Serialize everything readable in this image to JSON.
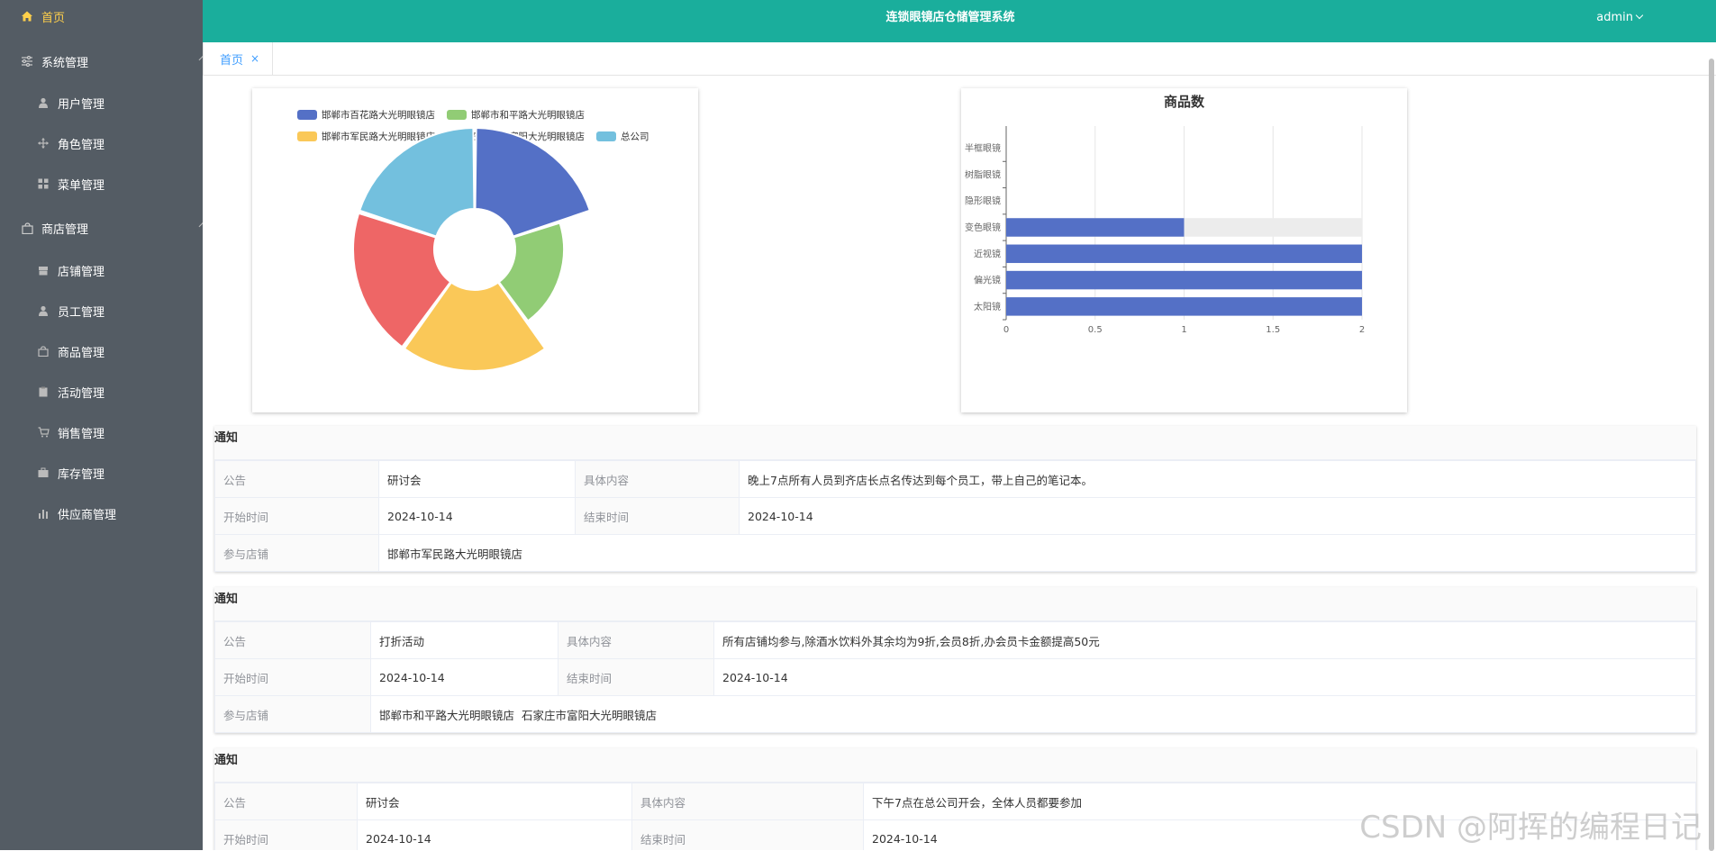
{
  "app": {
    "title": "连锁眼镜店仓储管理系统",
    "user": "admin"
  },
  "sidebar": {
    "home": "首页",
    "groups": [
      {
        "label": "系统管理",
        "items": [
          "用户管理",
          "角色管理",
          "菜单管理"
        ]
      },
      {
        "label": "商店管理",
        "items": [
          "店铺管理",
          "员工管理",
          "商品管理",
          "活动管理",
          "销售管理",
          "库存管理",
          "供应商管理"
        ]
      }
    ]
  },
  "tabs": [
    {
      "label": "首页",
      "close": "×"
    }
  ],
  "colors": {
    "sidebar_bg": "#545c64",
    "header_bg": "#1aae9c",
    "active_menu": "#ffd04b",
    "accent": "#409eff"
  },
  "chart_data": [
    {
      "type": "pie",
      "donut": true,
      "legend": [
        "邯郸市百花路大光明眼镜店",
        "邯郸市和平路大光明眼镜店",
        "邯郸市军民路大光明眼镜店",
        "石家庄市富阳大光明眼镜店",
        "总公司"
      ],
      "colors": [
        "#5470c6",
        "#91cc75",
        "#fac858",
        "#ee6666",
        "#73c0de"
      ],
      "values": [
        1,
        1,
        1,
        1,
        1
      ],
      "radius_values": [
        1.0,
        0.6,
        1.0,
        1.0,
        1.0
      ]
    },
    {
      "type": "bar",
      "orientation": "horizontal",
      "title": "商品数",
      "categories": [
        "太阳镜",
        "偏光镜",
        "近视镜",
        "变色眼镜",
        "隐形眼镜",
        "树脂眼镜",
        "半框眼镜"
      ],
      "values": [
        2,
        2,
        2,
        1,
        0,
        0,
        0
      ],
      "xlim": [
        0,
        2
      ],
      "xticks": [
        "0",
        "0.5",
        "1",
        "1.5",
        "2"
      ],
      "bar_color": "#5470c6",
      "grid": true
    }
  ],
  "notices": [
    {
      "title": "通知",
      "labels": {
        "notice": "公告",
        "content": "具体内容",
        "start": "开始时间",
        "end": "结束时间",
        "stores": "参与店铺"
      },
      "notice": "研讨会",
      "content": "晚上7点所有人员到齐店长点名传达到每个员工，带上自己的笔记本。",
      "start": "2024-10-14",
      "end": "2024-10-14",
      "stores": "邯郸市军民路大光明眼镜店"
    },
    {
      "title": "通知",
      "labels": {
        "notice": "公告",
        "content": "具体内容",
        "start": "开始时间",
        "end": "结束时间",
        "stores": "参与店铺"
      },
      "notice": "打折活动",
      "content": "所有店铺均参与,除酒水饮料外其余均为9折,会员8折,办会员卡金额提高50元",
      "start": "2024-10-14",
      "end": "2024-10-14",
      "stores": "邯郸市和平路大光明眼镜店  石家庄市富阳大光明眼镜店"
    },
    {
      "title": "通知",
      "labels": {
        "notice": "公告",
        "content": "具体内容",
        "start": "开始时间",
        "end": "结束时间"
      },
      "notice": "研讨会",
      "content": "下午7点在总公司开会，全体人员都要参加",
      "start": "2024-10-14",
      "end": "2024-10-14"
    }
  ],
  "watermark": "CSDN @阿挥的编程日记"
}
